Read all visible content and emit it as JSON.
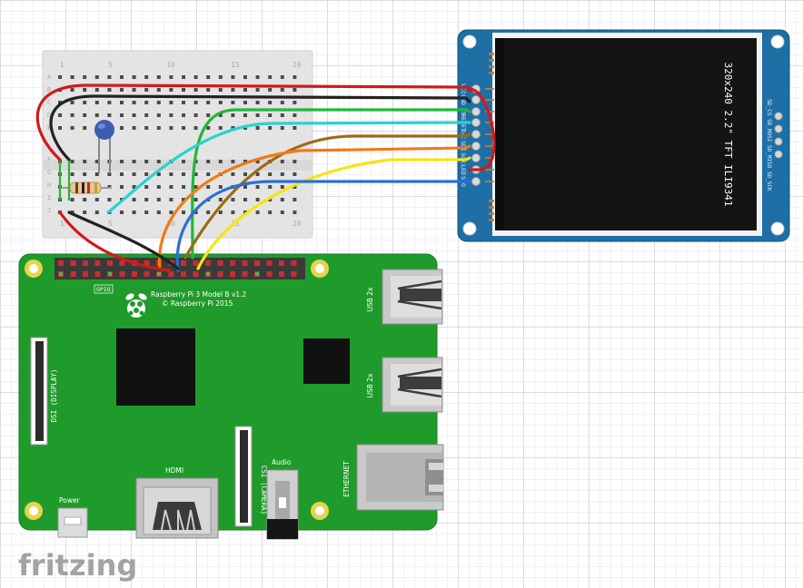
{
  "breadboard": {
    "column_numbers": [
      "1",
      "5",
      "10",
      "15",
      "20"
    ],
    "row_letters": [
      "A",
      "B",
      "C",
      "D",
      "E",
      "F",
      "G",
      "H",
      "I",
      "J"
    ]
  },
  "raspberry_pi": {
    "model": "Raspberry Pi 3 Model B v1.2",
    "copyright": "© Raspberry Pi 2015",
    "gpio_label": "GPIO",
    "dsi_label": "DSI (DISPLAY)",
    "csi_label": "CSI (CAMERA)",
    "hdmi_label": "HDMI",
    "audio_label": "Audio",
    "power_label": "Power",
    "ethernet_label": "ETHERNET",
    "usb_label_1": "USB 2x",
    "usb_label_2": "USB 2x"
  },
  "tft": {
    "title": "320x240 2.2\" TFT ILI9341",
    "pins": [
      "VCC",
      "GND",
      "CS",
      "RESET",
      "D/C",
      "SDI",
      "SCK",
      "LED",
      "SDO"
    ],
    "sd_pins": "SD_CS  SD_MOSI  SD_MISO  SD_SCK"
  },
  "wire_colors": {
    "red": "#d11a1a",
    "black": "#222222",
    "green": "#1fb83a",
    "cyan": "#2ad2d0",
    "brown": "#9b6b14",
    "orange": "#f07a18",
    "yellow": "#f5e512",
    "blue": "#2b6fd6"
  },
  "watermark": "fritzing"
}
